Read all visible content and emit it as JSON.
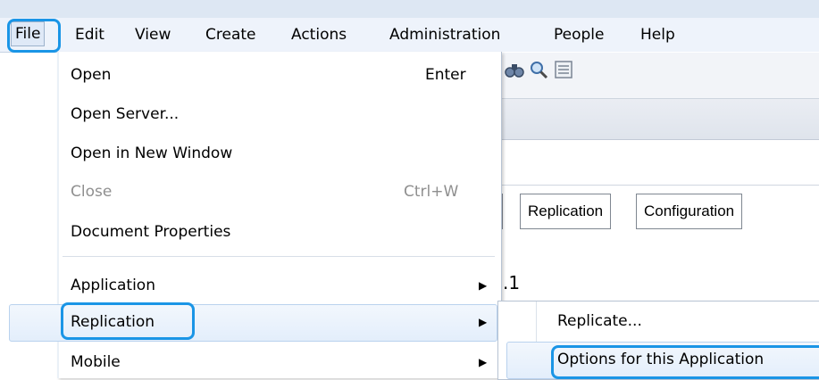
{
  "menubar": {
    "items": [
      "File",
      "Edit",
      "View",
      "Create",
      "Actions",
      "Administration",
      "People",
      "Help"
    ]
  },
  "file_menu": {
    "items": [
      {
        "label": "Open",
        "shortcut": "Enter",
        "enabled": true
      },
      {
        "label": "Open Server...",
        "enabled": true
      },
      {
        "label": "Open in New Window",
        "enabled": true
      },
      {
        "label": "Close",
        "shortcut": "Ctrl+W",
        "enabled": false
      },
      {
        "label": "Document Properties",
        "enabled": true
      },
      {
        "label": "Application",
        "submenu": true,
        "enabled": true
      },
      {
        "label": "Replication",
        "submenu": true,
        "enabled": true,
        "selected": true
      },
      {
        "label": "Mobile",
        "submenu": true,
        "enabled": true
      }
    ]
  },
  "replication_submenu": {
    "items": [
      {
        "label": "Replicate..."
      },
      {
        "label": "Options for this Application",
        "selected": true
      }
    ]
  },
  "background": {
    "tabs": [
      "Replication",
      "Configuration"
    ],
    "fragment_text": ".1"
  },
  "colors": {
    "highlight_outline": "#1a95e6",
    "selection_fill": "#e3eefb",
    "menubar_bg": "#eef3fb"
  }
}
